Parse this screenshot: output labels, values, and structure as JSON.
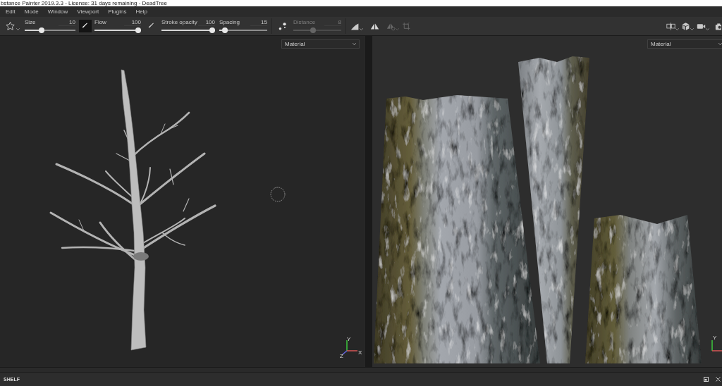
{
  "title_bar": {
    "title": "bstance Painter 2019.3.3 - License: 31 days remaining - DeadTree"
  },
  "menu_bar": {
    "items": [
      "Edit",
      "Mode",
      "Window",
      "Viewport",
      "Plugins",
      "Help"
    ]
  },
  "toolbar": {
    "sliders": [
      {
        "label": "Size",
        "value": "10",
        "level": 0.32,
        "disabled": false
      },
      {
        "label": "Flow",
        "value": "100",
        "level": 1,
        "disabled": false
      },
      {
        "label": "Stroke opacity",
        "value": "100",
        "level": 1,
        "disabled": false
      },
      {
        "label": "Spacing",
        "value": "15",
        "level": 0.06,
        "disabled": false
      },
      {
        "label": "Distance",
        "value": "8",
        "level": 0.4,
        "disabled": true
      }
    ],
    "brush_toggles": [
      {
        "selected": true
      },
      {
        "selected": false
      }
    ],
    "symmetry_tools": [
      {
        "disabled": false
      },
      {
        "disabled": true
      },
      {
        "disabled": true
      }
    ]
  },
  "viewports": [
    {
      "kind": "model",
      "dropdown": "Material",
      "axis_labels": [
        "Y",
        "X",
        "Z"
      ]
    },
    {
      "kind": "texture",
      "dropdown": "Material",
      "axis_labels": [
        "Y"
      ]
    }
  ],
  "shelf": {
    "title": "SHELF"
  }
}
